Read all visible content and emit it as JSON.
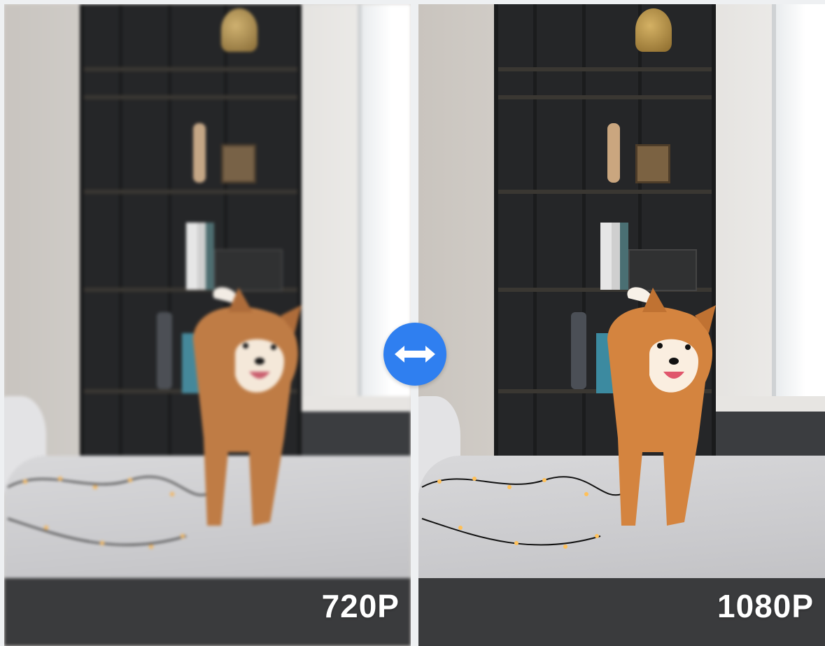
{
  "comparison": {
    "left_label": "720P",
    "right_label": "1080P",
    "swap_icon": "double-arrow-horizontal-icon",
    "accent_color": "#2f7ff0"
  }
}
